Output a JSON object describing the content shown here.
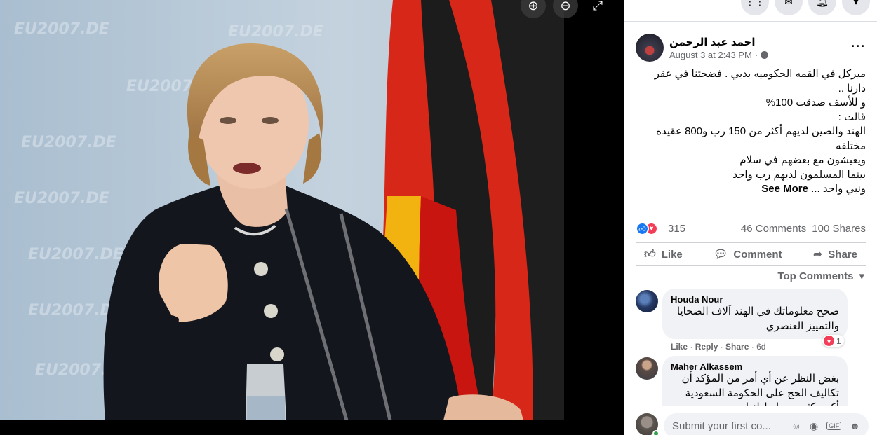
{
  "viewer": {
    "tools": [
      {
        "icon": "zoom-in-icon",
        "glyph": "⊕"
      },
      {
        "icon": "zoom-out-icon",
        "glyph": "⊖"
      },
      {
        "icon": "fullscreen-icon",
        "glyph": "⤢"
      }
    ],
    "photo_watermark": "EU2007.DE"
  },
  "topbar": {
    "icons": [
      "menu-grid-icon",
      "messenger-icon",
      "notifications-icon",
      "account-caret-icon"
    ]
  },
  "post": {
    "author": "احمد عبد الرحمن",
    "timestamp": "August 3 at 2:43 PM",
    "privacy_icon": "globe-icon",
    "text_lines": [
      "ميركل في القمه الحكوميه بدبي . فضحتنا في عقر دارنا ..",
      "و للأسف صدقت 100%",
      "قالت :",
      "الهند والصين لديهم أكثر من 150 رب و800 عقيده مختلفه",
      "ويعيشون مع بعضهم في سلام",
      "بينما المسلمون لديهم رب واحد",
      "ونبي واحد ..."
    ],
    "see_more": "See More",
    "reaction_count": "315",
    "comments_count": "46 Comments",
    "shares_count": "100 Shares",
    "actions": {
      "like": "Like",
      "comment": "Comment",
      "share": "Share"
    },
    "sort_label": "Top Comments"
  },
  "comments": [
    {
      "name": "Houda Nour",
      "text": "صحح معلوماتك في الهند آلاف الضحايا والتمييز العنصري",
      "like": "Like",
      "reply": "Reply",
      "share": "Share",
      "age": "6d",
      "reaction_count": "1"
    },
    {
      "name": "Maher Alkassem",
      "text": "بغض النظر عن أي أمر من المؤكد أن تكاليف الحج على الحكومة السعودية أكبر بكثير من إيراداتها"
    }
  ],
  "composer": {
    "placeholder": "Submit your first co...",
    "icons": [
      "emoji-icon",
      "camera-icon",
      "gif-icon",
      "sticker-icon"
    ]
  },
  "colors": {
    "facebook_blue": "#1877f2",
    "love_red": "#f33e58",
    "secondary_text": "#65676b"
  }
}
